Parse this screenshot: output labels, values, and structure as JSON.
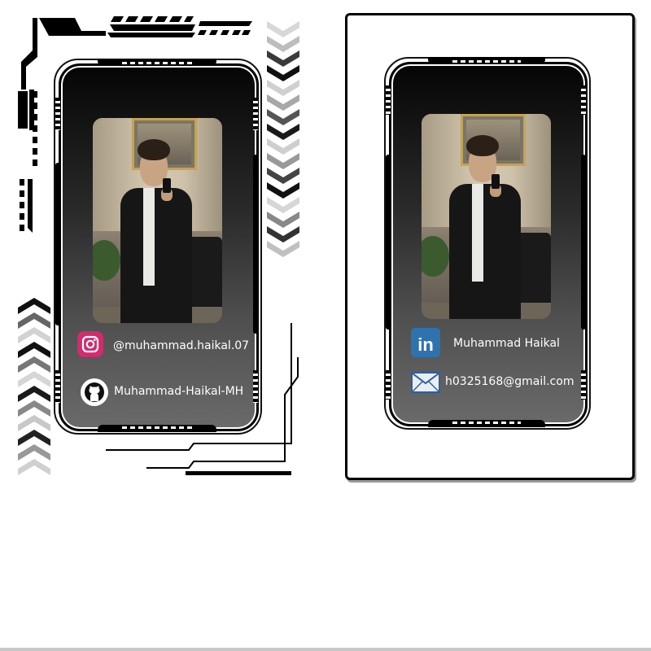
{
  "left_card": {
    "instagram_handle": "@muhammad.haikal.07",
    "github_username": "Muhammad-Haikal-MH",
    "icons": [
      "instagram-icon",
      "github-icon"
    ]
  },
  "right_card": {
    "linkedin_name": "Muhammad Haikal",
    "email": "h0325168@gmail.com",
    "icons": [
      "linkedin-icon",
      "mail-icon"
    ]
  },
  "colors": {
    "instagram": "#d12c6d",
    "linkedin": "#2f72b0",
    "card_top": "#050505",
    "card_bottom": "#6a6a6a"
  }
}
